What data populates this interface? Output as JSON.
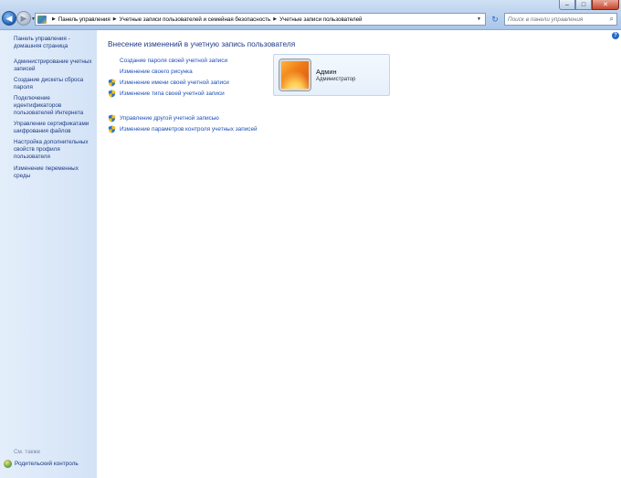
{
  "window": {
    "minimize": "–",
    "maximize": "□",
    "close": "✕"
  },
  "nav": {
    "back_icon": "arrow-left-icon",
    "forward_icon": "arrow-right-icon"
  },
  "address": {
    "crumbs": [
      "Панель управления",
      "Учетные записи пользователей и семейная безопасность",
      "Учетные записи пользователей"
    ]
  },
  "search": {
    "placeholder": "Поиск в панели управления"
  },
  "sidebar": {
    "items": [
      {
        "label": "Панель управления - домашняя страница"
      },
      {
        "label": "Администрирование учетных записей"
      },
      {
        "label": "Создание дискеты сброса пароля"
      },
      {
        "label": "Подключение идентификаторов пользователей Интернета"
      },
      {
        "label": "Управление сертификатами шифрования файлов"
      },
      {
        "label": "Настройка дополнительных свойств профиля пользователя"
      },
      {
        "label": "Изменение переменных среды"
      }
    ],
    "see_also": "См. также",
    "parental_control": "Родительский контроль"
  },
  "main": {
    "title": "Внесение изменений в учетную запись пользователя",
    "tasks": [
      {
        "label": "Создание пароля своей учетной записи",
        "shield": false
      },
      {
        "label": "Изменение своего рисунка",
        "shield": false
      },
      {
        "label": "Изменение имени своей учетной записи",
        "shield": true
      },
      {
        "label": "Изменение типа своей учетной записи",
        "shield": true
      }
    ],
    "tasks2": [
      {
        "label": "Управление другой учетной записью",
        "shield": true
      },
      {
        "label": "Изменение параметров контроля учетных записей",
        "shield": true
      }
    ]
  },
  "user": {
    "name": "Админ",
    "role": "Администратор"
  },
  "help": "?"
}
